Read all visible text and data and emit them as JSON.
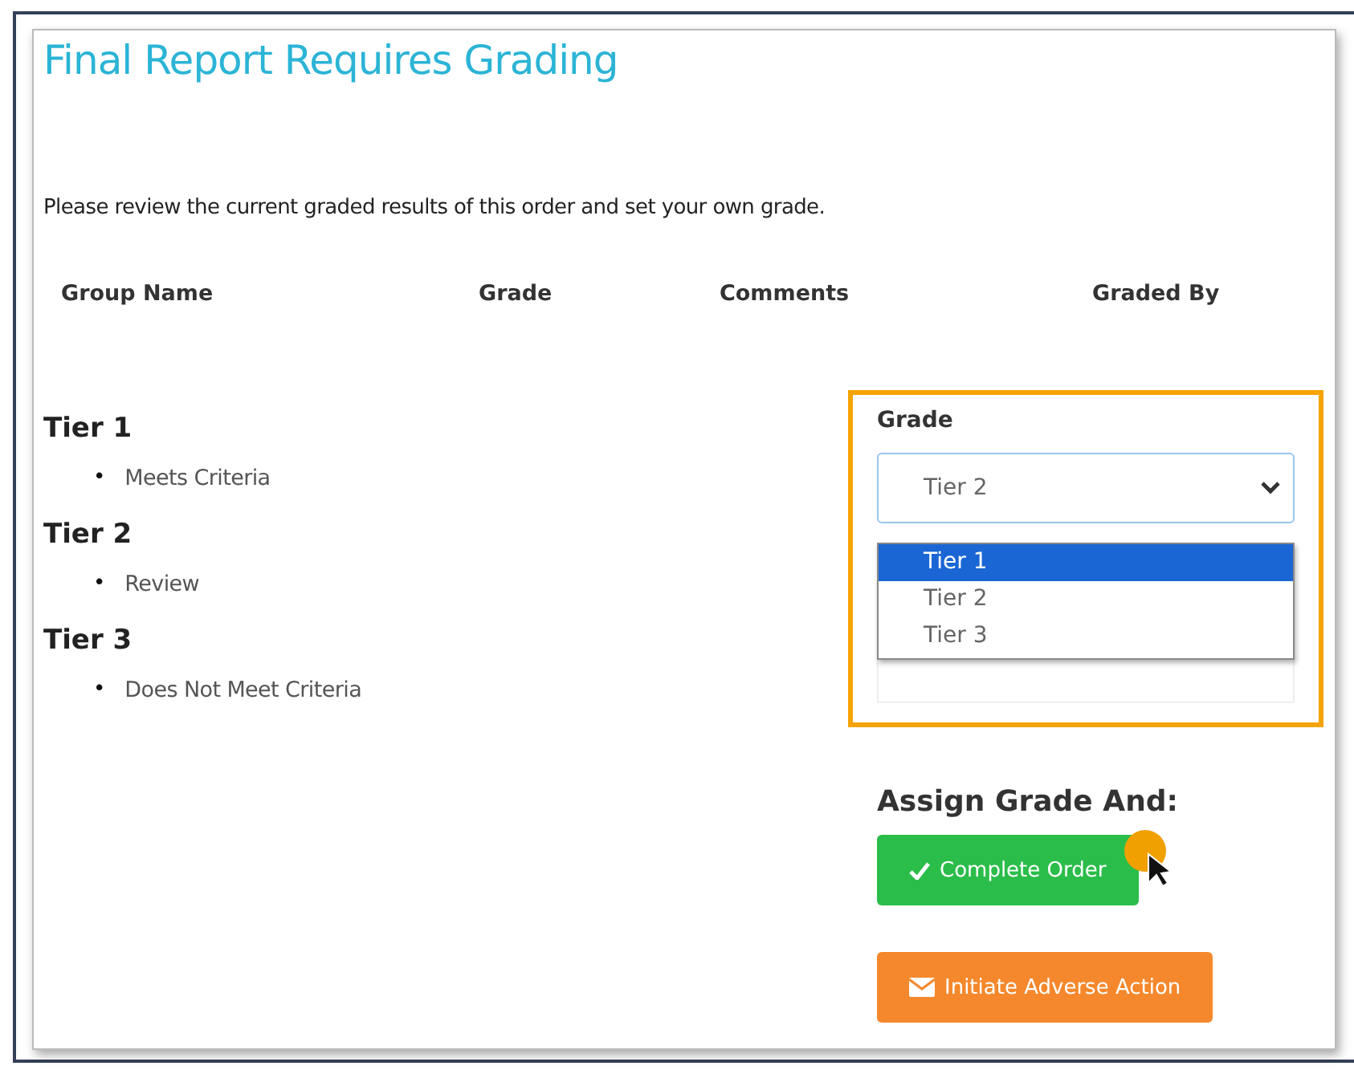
{
  "title": "Final Report Requires Grading",
  "intro": "Please review the current graded results of this order and set your own grade.",
  "columns": [
    "Group Name",
    "Grade",
    "Comments",
    "Graded By"
  ],
  "tiers": [
    {
      "name": "Tier 1",
      "items": [
        {
          "bullet": "•",
          "text": "Meets Criteria"
        }
      ]
    },
    {
      "name": "Tier 2",
      "items": [
        {
          "bullet": "•",
          "text": "Review"
        }
      ]
    },
    {
      "name": "Tier 3",
      "items": [
        {
          "bullet": "•",
          "text": "Does Not Meet Criteria"
        }
      ]
    }
  ],
  "grade_panel": {
    "label": "Grade",
    "value": "Tier 2",
    "expanded": true,
    "options": [
      {
        "label": "Tier 1",
        "highlighted": true
      },
      {
        "label": "Tier 2",
        "highlighted": false
      },
      {
        "label": "Tier 3",
        "highlighted": false
      }
    ]
  },
  "actions": {
    "heading": "Assign Grade And:",
    "buttons": [
      {
        "label": "Complete Order",
        "kind": "complete"
      },
      {
        "label": "Initiate Adverse Action",
        "kind": "adverse"
      }
    ]
  }
}
